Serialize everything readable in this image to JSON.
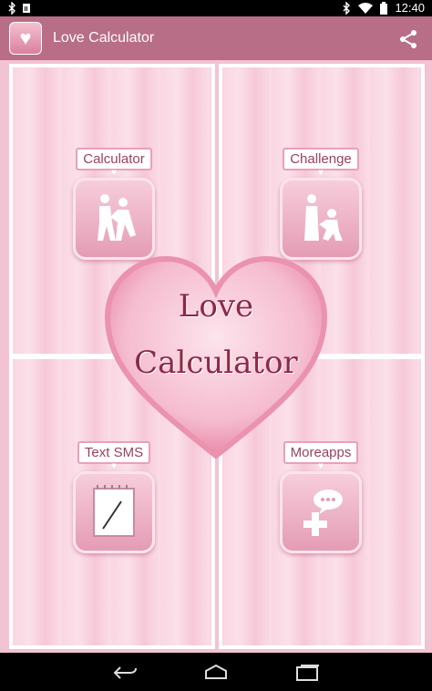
{
  "status_bar": {
    "time": "12:40",
    "left_icons": [
      "bluetooth-icon",
      "sim-icon"
    ],
    "right_icons": [
      "bluetooth-icon",
      "wifi-icon",
      "battery-icon"
    ]
  },
  "action_bar": {
    "title": "Love Calculator",
    "share_icon": "share-icon",
    "color": "#b86e86"
  },
  "tiles": [
    {
      "label": "Calculator",
      "icon": "couple-icon"
    },
    {
      "label": "Challenge",
      "icon": "proposal-icon"
    },
    {
      "label": "Text SMS",
      "icon": "notepad-icon"
    },
    {
      "label": "Moreapps",
      "icon": "add-chat-icon"
    }
  ],
  "center_heart": {
    "line1": "Love",
    "line2": "Calculator"
  },
  "nav_bar": {
    "buttons": [
      "back-icon",
      "home-icon",
      "recent-apps-icon"
    ]
  }
}
